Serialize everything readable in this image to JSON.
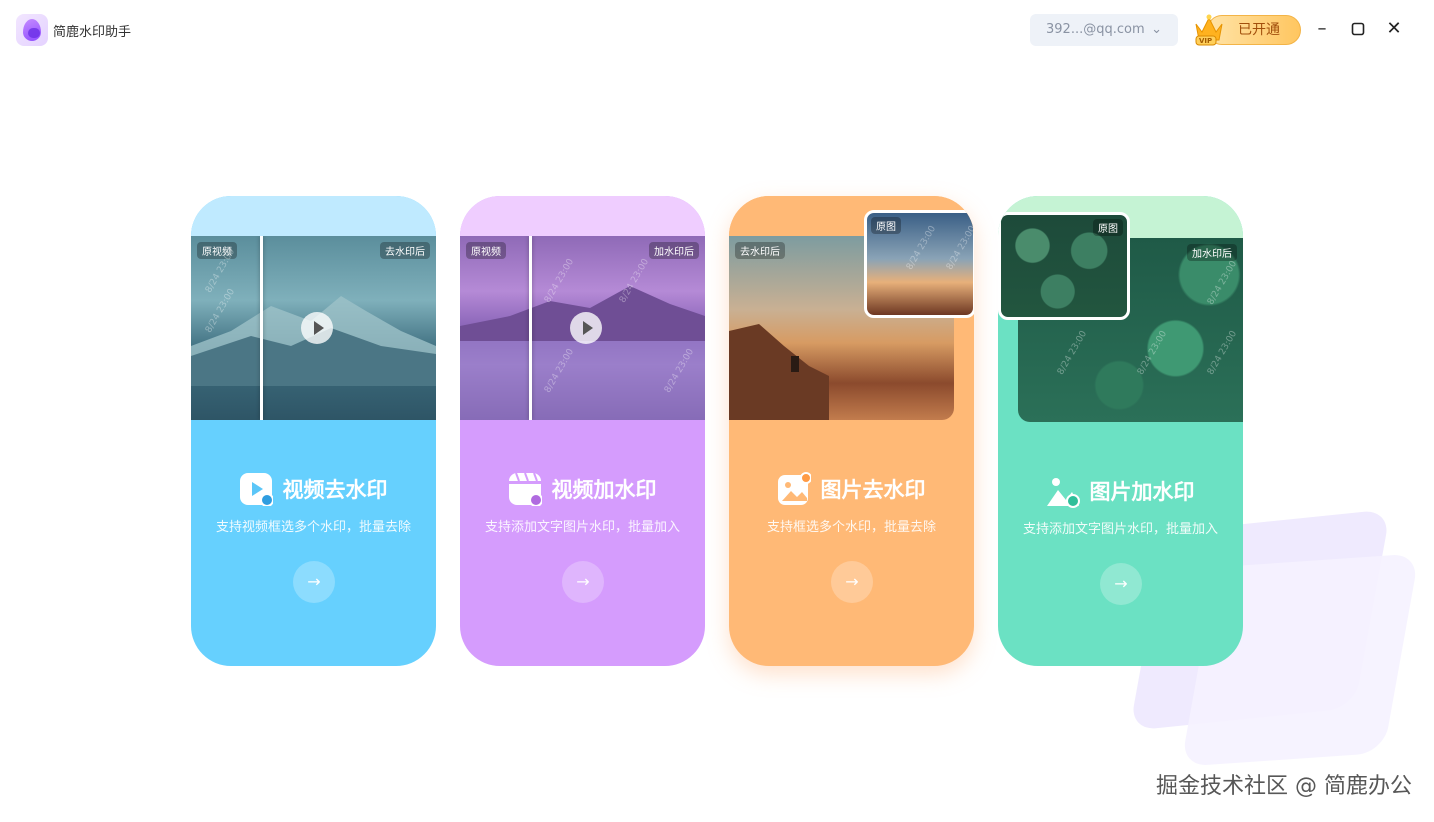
{
  "app": {
    "title": "简鹿水印助手"
  },
  "header": {
    "account": "392...@qq.com",
    "vip_badge": "VIP",
    "vip_status": "已开通"
  },
  "cards": [
    {
      "title": "视频去水印",
      "subtitle": "支持视频框选多个水印，批量去除",
      "label_left": "原视频",
      "label_right": "去水印后",
      "color": "#66d0fe"
    },
    {
      "title": "视频加水印",
      "subtitle": "支持添加文字图片水印，批量加入",
      "label_left": "原视频",
      "label_right": "加水印后",
      "color": "#d59cfd"
    },
    {
      "title": "图片去水印",
      "subtitle": "支持框选多个水印，批量去除",
      "label_left": "去水印后",
      "label_right": "原图",
      "color": "#ffb976"
    },
    {
      "title": "图片加水印",
      "subtitle": "支持添加文字图片水印，批量加入",
      "label_left": "原图",
      "label_right": "加水印后",
      "color": "#6be1c3"
    }
  ],
  "overlay_text": "掘金技术社区 @ 简鹿办公",
  "photo_watermark": "8/24 23:00"
}
